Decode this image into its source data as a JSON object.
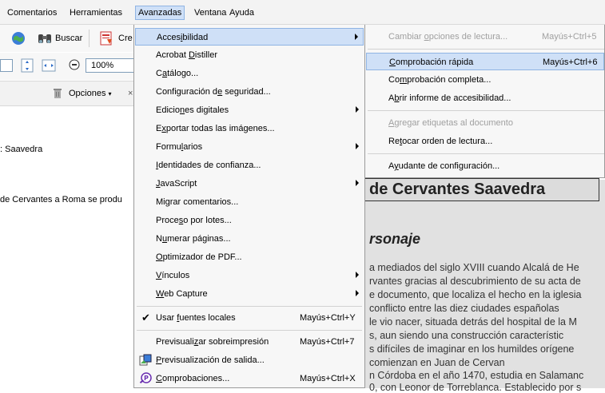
{
  "menubar": {
    "items": [
      {
        "label": "Comentarios"
      },
      {
        "label": "Herramientas"
      },
      {
        "label": "Avanzadas"
      },
      {
        "label": "Ventana"
      },
      {
        "label": "Ayuda"
      }
    ]
  },
  "toolbar": {
    "search_label": "Buscar",
    "create_label": "Cre",
    "zoom_value": "100%",
    "options_label": "Opciones"
  },
  "document": {
    "left_line1": ": Saavedra",
    "left_line2": "de Cervantes a Roma se produ",
    "title": "de Cervantes Saavedra",
    "subtitle": "rsonaje",
    "body_lines": [
      "a mediados del siglo XVIII cuando Alcalá de He",
      "rvantes gracias al descubrimiento de su acta de",
      "e documento, que localiza el hecho en la iglesia",
      "conflicto entre las diez ciudades españolas",
      "le vio nacer, situada detrás del hospital de la M",
      "s, aun siendo una construcción característic",
      "s difíciles de imaginar en los humildes orígene",
      "comienzan      en      Juan      de      Cervan",
      "n Córdoba en el año 1470, estudia en Salamanc",
      "0, con Leonor de Torreblanca. Establecido por s"
    ]
  },
  "advanced_menu": {
    "items": [
      {
        "pre": "Acces",
        "u": "i",
        "post": "bilidad",
        "shortcut": "",
        "submenu": true
      },
      {
        "pre": "Acrobat ",
        "u": "D",
        "post": "istiller",
        "shortcut": "",
        "submenu": false
      },
      {
        "pre": "C",
        "u": "a",
        "post": "tálogo...",
        "shortcut": "",
        "submenu": false
      },
      {
        "pre": "Configuración d",
        "u": "e",
        "post": " seguridad...",
        "shortcut": "",
        "submenu": false
      },
      {
        "pre": "Edicio",
        "u": "n",
        "post": "es digitales",
        "shortcut": "",
        "submenu": true
      },
      {
        "pre": "E",
        "u": "x",
        "post": "portar todas las imágenes...",
        "shortcut": "",
        "submenu": false
      },
      {
        "pre": "Formu",
        "u": "l",
        "post": "arios",
        "shortcut": "",
        "submenu": true
      },
      {
        "pre": "",
        "u": "I",
        "post": "dentidades de confianza...",
        "shortcut": "",
        "submenu": false
      },
      {
        "pre": "",
        "u": "J",
        "post": "avaScript",
        "shortcut": "",
        "submenu": true
      },
      {
        "pre": "Mi",
        "u": "g",
        "post": "rar comentarios...",
        "shortcut": "",
        "submenu": false
      },
      {
        "pre": "Proce",
        "u": "s",
        "post": "o por lotes...",
        "shortcut": "",
        "submenu": false
      },
      {
        "pre": "N",
        "u": "u",
        "post": "merar páginas...",
        "shortcut": "",
        "submenu": false
      },
      {
        "pre": "",
        "u": "O",
        "post": "ptimizador de PDF...",
        "shortcut": "",
        "submenu": false
      },
      {
        "pre": "",
        "u": "V",
        "post": "ínculos",
        "shortcut": "",
        "submenu": true
      },
      {
        "pre": "",
        "u": "W",
        "post": "eb Capture",
        "shortcut": "",
        "submenu": true
      },
      {
        "pre": "Usar ",
        "u": "f",
        "post": "uentes locales",
        "shortcut": "Mayús+Ctrl+Y",
        "submenu": false
      },
      {
        "pre": "Previsuali",
        "u": "z",
        "post": "ar sobreimpresión",
        "shortcut": "Mayús+Ctrl+7",
        "submenu": false
      },
      {
        "pre": "",
        "u": "P",
        "post": "revisualización de salida...",
        "shortcut": "",
        "submenu": false
      },
      {
        "pre": "",
        "u": "C",
        "post": "omprobaciones...",
        "shortcut": "Mayús+Ctrl+X",
        "submenu": false
      }
    ]
  },
  "accessibility_submenu": {
    "items": [
      {
        "pre": "Cambiar ",
        "u": "o",
        "post": "pciones de lectura...",
        "shortcut": "Mayús+Ctrl+5",
        "disabled": true
      },
      {
        "pre": "",
        "u": "C",
        "post": "omprobación rápida",
        "shortcut": "Mayús+Ctrl+6",
        "disabled": false
      },
      {
        "pre": "Co",
        "u": "m",
        "post": "probación completa...",
        "shortcut": "",
        "disabled": false
      },
      {
        "pre": "A",
        "u": "b",
        "post": "rir informe de accesibilidad...",
        "shortcut": "",
        "disabled": false
      },
      {
        "pre": "",
        "u": "A",
        "post": "gregar etiquetas al documento",
        "shortcut": "",
        "disabled": true
      },
      {
        "pre": "Re",
        "u": "t",
        "post": "ocar orden de lectura...",
        "shortcut": "",
        "disabled": false
      },
      {
        "pre": "A",
        "u": "y",
        "post": "udante de configuración...",
        "shortcut": "",
        "disabled": false
      }
    ]
  },
  "colors": {
    "highlight": "#cfe0f7",
    "highlight_border": "#8fb4e3",
    "menu_bg": "#f7f7f7",
    "disabled_text": "#a0a0a0"
  }
}
